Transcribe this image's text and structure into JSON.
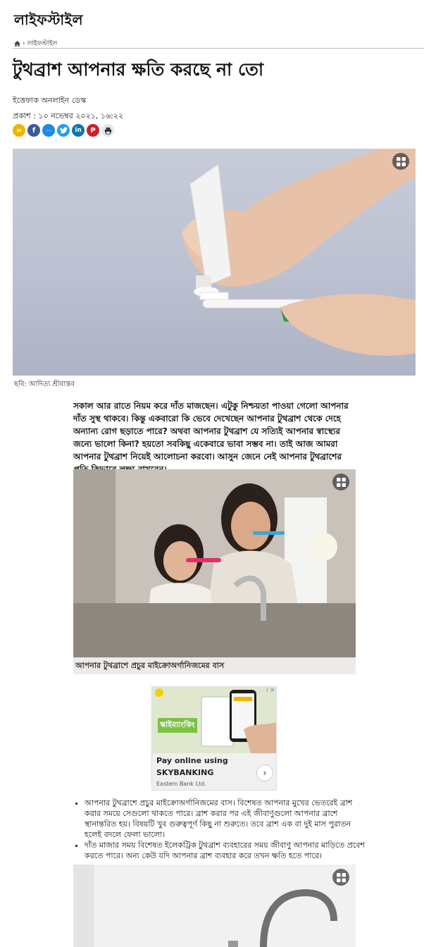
{
  "section": {
    "title": "লাইফস্টাইল"
  },
  "breadcrumb": {
    "current": "লাইফস্টাইল",
    "separator": "›"
  },
  "article": {
    "headline": "টুথব্রাশ আপনার ক্ষতি করছে না তো",
    "author": "ইত্তেফাক অনলাইন ডেস্ক",
    "published": "প্রকাশ : ১০ নভেম্বর ২০২১, ১৬:২২",
    "lead": "সকাল আর রাতে নিয়ম করে দাঁত মাজছেন। এটুকু নিশ্চয়তা পাওয়া গেলো আপনার দাঁত সুস্থ থাকবে। কিন্তু একবারো কি ভেবে দেখেছেন আপনার টুথব্রাশ থেকে দেহে অন্যান্য রোগ ছড়াতে পারে? অথবা আপনার টুথব্রাশ যে সত্যিই আপনার স্বাস্থ্যের জন্যে ভালো কিনা? হয়তো সবকিছু একেবারে ভাবা সম্ভব না। তাই আজ আমরা আপনার টুথব্রাশ নিয়েই আলোচনা করবো। আসুন জেনে নেই আপনার টুথব্রাশের প্রতি কিভাবে লক্ষ্য রাখবেন।",
    "image1_caption": "ছবি: আদিত্য শ্রীবাস্তব",
    "image2_caption": "আপনার টুথব্রাশে প্রচুর মাইক্রোঅর্গানিজমের বাস",
    "bullets": [
      "আপনার টুথব্রাশে প্রচুর মাইক্রোঅর্গানিজমের বাস। বিশেষত আপনার মুখের ভেতরেই ব্রাশ করার সময়ে সেগুলো থাকতে পারে। ব্রাশ করার পর এই জীবাণুগুলো আপনার ব্রাশে স্থানান্তরিত হয়। বিষয়টি খুব গুরুত্বপূর্ণ কিছু না শুরুতে। তবে ব্রাশ এক বা দুই মাস পুরাতন হলেই বদলে ফেলা ভালো।",
      "দাঁত মাজার সময় বিশেষত ইলেকট্রিক টুথব্রাশ ব্যবহারের সময় জীবাণু আপনার মাড়িতে প্রবেশ করতে পারে। অন্য কেউ যদি আপনার ব্রাশ ব্যবহার করে তখন ক্ষতি হতে পারে।"
    ]
  },
  "share": [
    {
      "name": "copy-link",
      "color": "#f0b400",
      "glyph": "∞"
    },
    {
      "name": "facebook",
      "color": "#3b5998",
      "glyph": "f"
    },
    {
      "name": "messenger",
      "color": "#1e88e5",
      "glyph": "~"
    },
    {
      "name": "twitter",
      "color": "#1da1f2",
      "glyph": "t"
    },
    {
      "name": "linkedin",
      "color": "#0e76a8",
      "glyph": "in"
    },
    {
      "name": "pinterest",
      "color": "#cb2027",
      "glyph": "P"
    },
    {
      "name": "print",
      "color": "#555555",
      "glyph": "⎙"
    }
  ],
  "ad": {
    "headline": "স্কাইব্যাংকিং",
    "cta": "Pay online using",
    "cta_bold": "SKYBANKING",
    "advertiser": "Eastern Bank Ltd.",
    "close": "✕",
    "info": "i"
  },
  "colors": {
    "ad_green": "#7cc242",
    "ad_bg": "#eef2e6"
  }
}
